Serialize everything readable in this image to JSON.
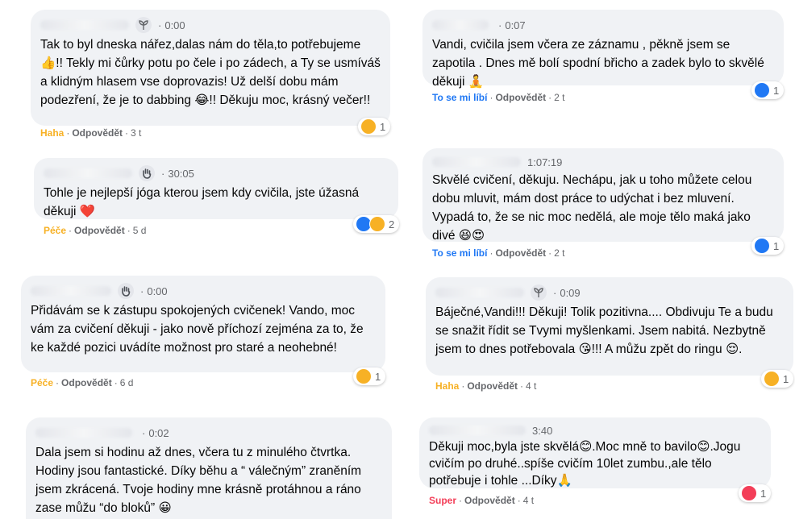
{
  "colors": {
    "bubble": "#f0f2f5",
    "meta_gray": "#65676b",
    "like_blue": "#2078f4",
    "haha_yellow": "#f7b125",
    "love_red": "#f33e58"
  },
  "labels": {
    "reply": "Odpovědět",
    "sep": "·"
  },
  "comments": [
    {
      "time": "0:00",
      "badge": "sprout-icon",
      "text": "Tak to byl dneska nářez,dalas nám do těla,to potřebujeme 👍!! Tekly mi čůrky potu po čele i po zádech, a Ty se usmíváš a klidným hlasem vse doprovazis! Už delší dobu mám podezření, že je to dabbing 😂!! Děkuju moc, krásný večer!!",
      "reaction_label": "Haha",
      "ago": "3 t",
      "count": "1"
    },
    {
      "time": "30:05",
      "badge": "wave-hand-icon",
      "text": "Tohle je nejlepší jóga kterou jsem kdy cvičila, jste úžasná děkuji ❤️",
      "reaction_label": "Péče",
      "ago": "5 d",
      "count": "2"
    },
    {
      "time": "0:00",
      "badge": "wave-hand-icon",
      "text": "Přidávám se k zástupu spokojených cvičenek! Vando, moc vám za cvičení děkuji - jako nově příchozí zejména za to, že ke každé pozici uvádíte možnost pro staré a neohebné!",
      "reaction_label": "Péče",
      "ago": "6 d",
      "count": "1"
    },
    {
      "time": "0:02",
      "badge": "",
      "text": "Dala jsem si hodinu až dnes, včera tu z minulého čtvrtka. Hodiny jsou fantastické. Díky běhu a “ válečným” zraněním jsem zkrácená. Tvoje hodiny mne krásně protáhnou a ráno zase můžu “do bloků” 😀",
      "reaction_label": "",
      "ago": "",
      "count": ""
    },
    {
      "time": "0:07",
      "badge": "",
      "text": "Vandi, cvičila jsem včera ze záznamu , pěkně jsem se zapotila . Dnes mě bolí spodní břicho a zadek bylo to skvělé děkuji 🧘",
      "reaction_label": "To se mi líbí",
      "ago": "2 t",
      "count": "1"
    },
    {
      "time": "1:07:19",
      "badge": "",
      "text": "Skvělé cvičení, děkuju. Nechápu, jak u toho můžete celou dobu mluvit, mám dost práce to udýchat i bez mluvení. Vypadá to, že se nic moc nedělá, ale moje tělo maká jako divé 😆😍",
      "reaction_label": "To se mi líbí",
      "ago": "2 t",
      "count": "1"
    },
    {
      "time": "0:09",
      "badge": "sprout-icon",
      "text": "Báječné,Vandi!!! Děkuji! Tolik pozitivna.... Obdivuju Te a budu se snažit řídit se Tvymi myšlenkami. Jsem nabitá. Nezbytně jsem to dnes potřebovala 😘!!! A můžu zpět do ringu 😌.",
      "reaction_label": "Haha",
      "ago": "4 t",
      "count": "1"
    },
    {
      "time": "3:40",
      "badge": "",
      "text": "Děkuji moc,byla jste skvělá😊.Moc mně to bavilo😊.Jogu cvičím po druhé..spíše cvičím 10let zumbu.,ale tělo potřebuje i tohle ...Díky🙏",
      "reaction_label": "Super",
      "ago": "4 t",
      "count": "1"
    }
  ]
}
